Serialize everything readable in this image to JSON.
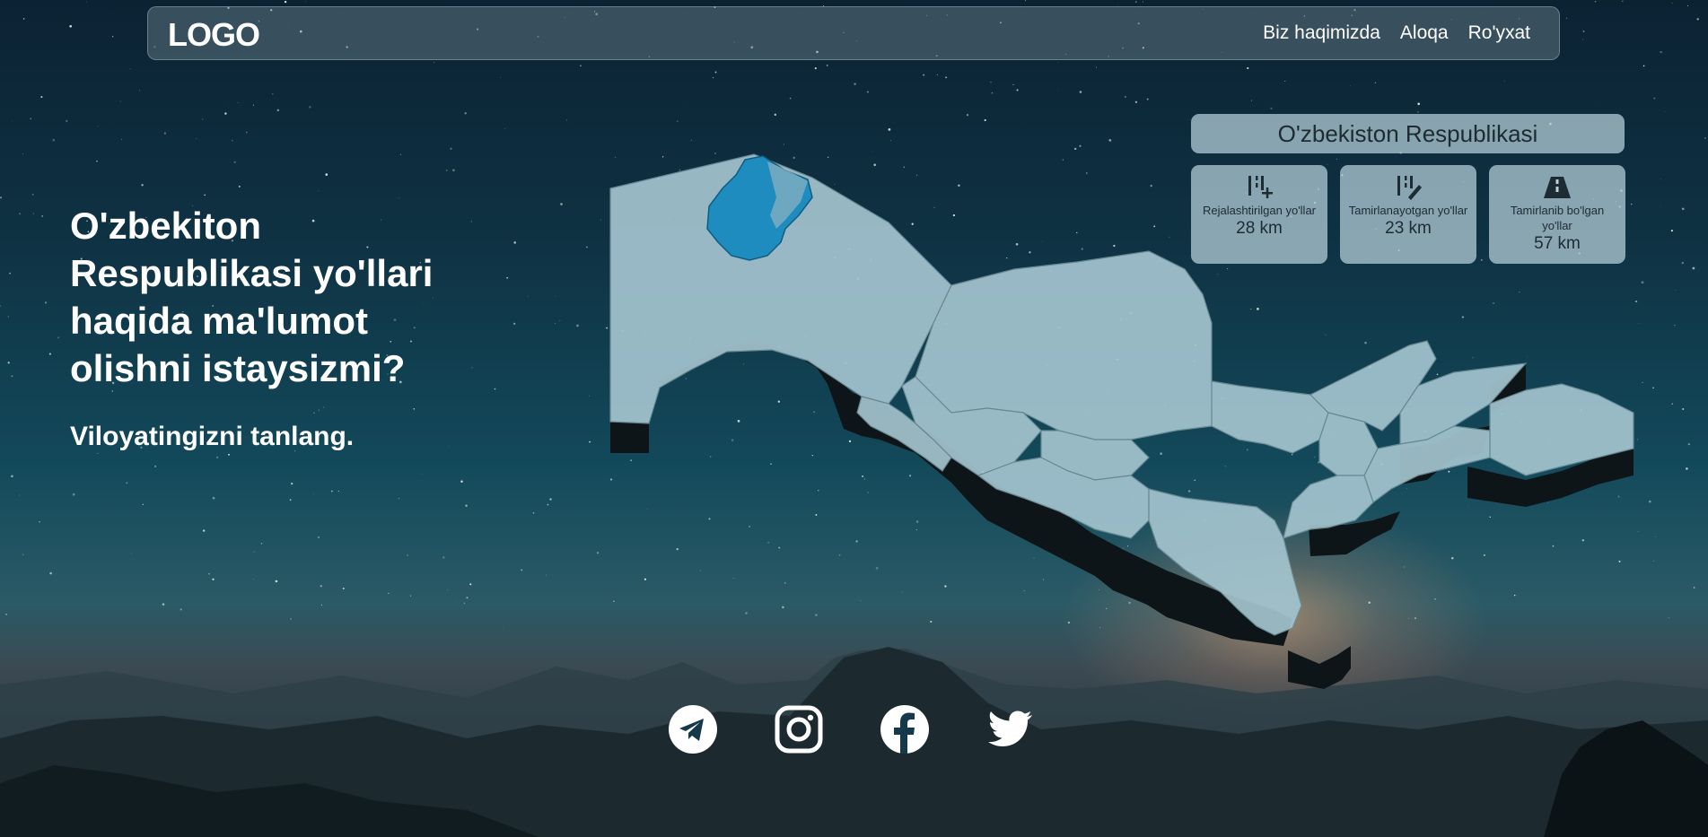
{
  "navbar": {
    "logo": "LOGO",
    "links": [
      "Biz haqimizda",
      "Aloqa",
      "Ro'yxat"
    ]
  },
  "hero": {
    "title": "O'zbekiton Respublikasi yo'llari haqida ma'lumot olishni istaysizmi?",
    "subtitle": "Viloyatingizni tanlang."
  },
  "info_panel": {
    "region_title": "O'zbekiston Respublikasi",
    "stats": [
      {
        "icon": "road-plus-icon",
        "label": "Rejalashtirilgan yo'llar",
        "value": "28 km"
      },
      {
        "icon": "road-repair-icon",
        "label": "Tamirlanayotgan yo'llar",
        "value": "23 km"
      },
      {
        "icon": "road-done-icon",
        "label": "Tamirlanib bo'lgan yo'llar",
        "value": "57 km"
      }
    ]
  },
  "map": {
    "highlighted_color": "#1f8cc0",
    "region_color": "#a3c4cf",
    "extrusion_color": "#0d1518"
  },
  "socials": [
    "telegram-icon",
    "instagram-icon",
    "facebook-icon",
    "twitter-icon"
  ]
}
